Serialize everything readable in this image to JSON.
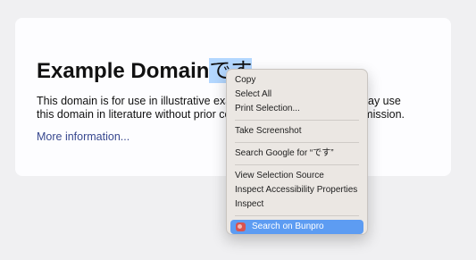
{
  "page": {
    "heading_main": "Example Domain",
    "heading_selected": "です",
    "paragraph": "This domain is for use in illustrative examples in documents. You may use this domain in literature without prior coordination or asking for permission.",
    "link": "More information..."
  },
  "context_menu": {
    "items_group1": [
      "Copy",
      "Select All",
      "Print Selection..."
    ],
    "items_group2": [
      "Take Screenshot"
    ],
    "items_group3": [
      "Search Google for “です”"
    ],
    "items_group4": [
      "View Selection Source",
      "Inspect Accessibility Properties",
      "Inspect"
    ],
    "highlighted_item": "Search on Bunpro",
    "highlighted_icon": "bunpro-icon"
  },
  "colors": {
    "selection": "#b3d7ff",
    "link": "#38488f",
    "menu_highlight": "#5d9cf2"
  }
}
